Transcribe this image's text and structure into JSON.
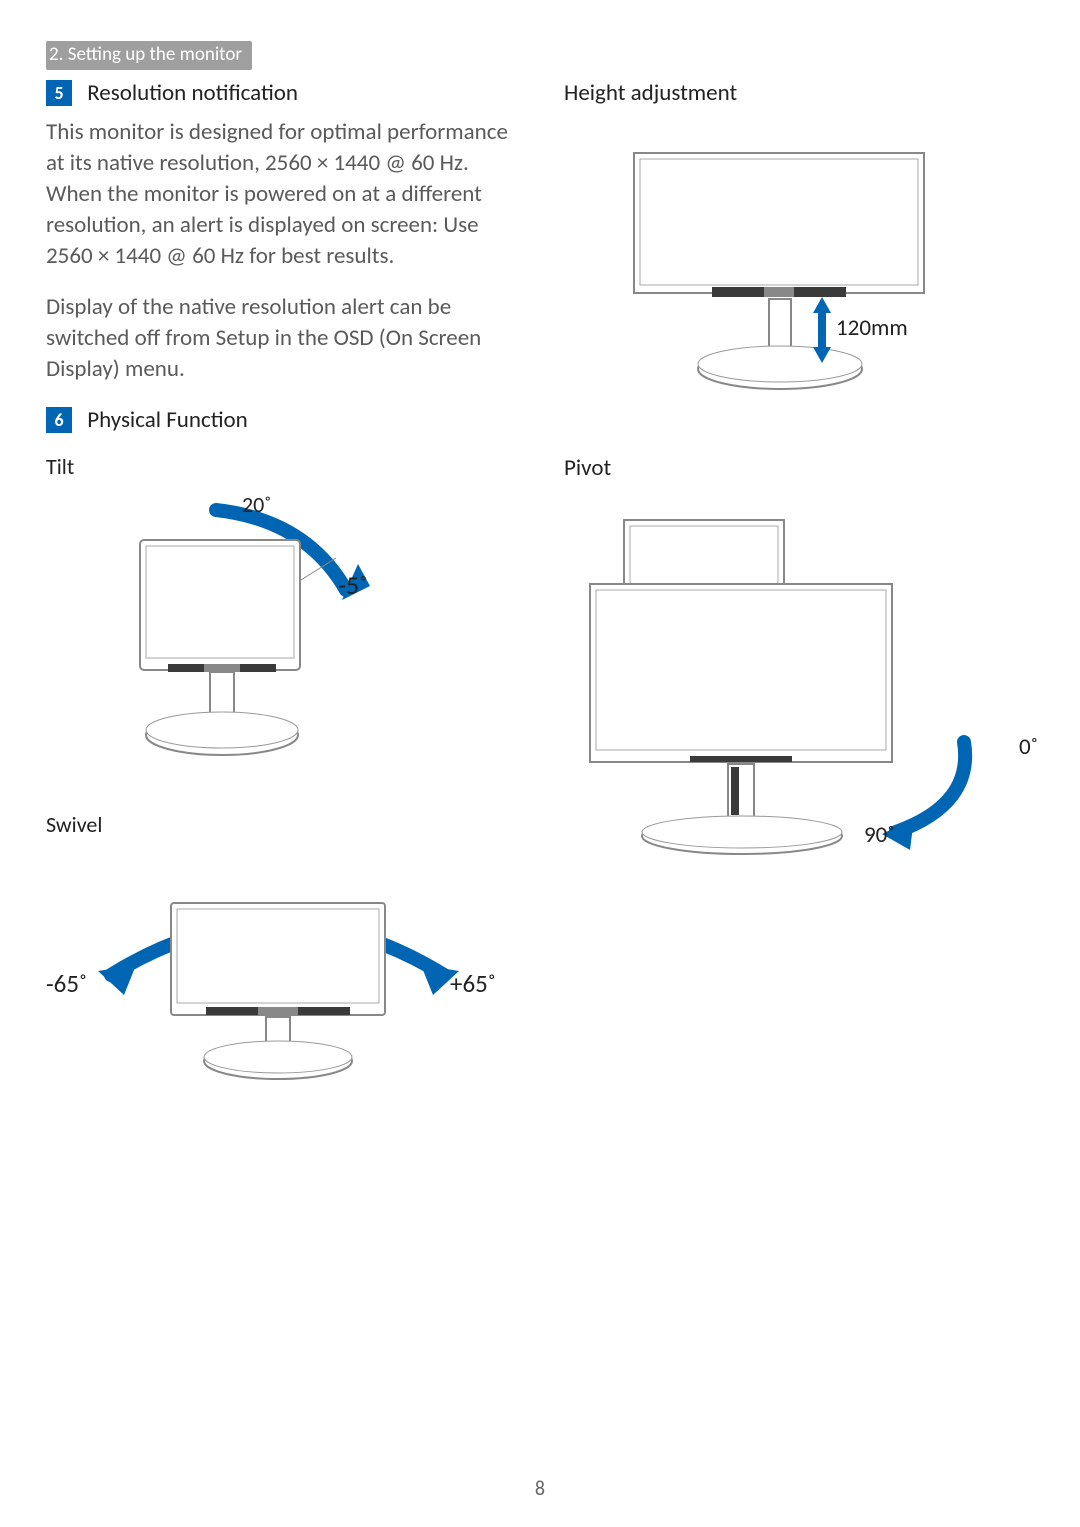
{
  "section_tag": "2. Setting up the monitor",
  "left": {
    "item5_num": "5",
    "item5_title": "Resolution notification",
    "para1": "This monitor is designed for optimal performance at its native resolution, 2560 × 1440 @ 60 Hz. When the monitor is powered on at a different resolution, an alert is displayed on screen: Use 2560 × 1440 @ 60 Hz for best results.",
    "para2": "Display of the native resolution alert can be switched off from Setup in the OSD (On Screen Display) menu.",
    "item6_num": "6",
    "item6_title": "Physical Function",
    "tilt_h": "Tilt",
    "tilt_back": "20˚",
    "tilt_fwd": "-5˚",
    "swivel_h": "Swivel",
    "swivel_left": "-65˚",
    "swivel_right": "+65˚"
  },
  "right": {
    "height_h": "Height adjustment",
    "height_val": "120mm",
    "pivot_h": "Pivot",
    "pivot_top": "0˚",
    "pivot_bot": "90˚"
  },
  "page_number": "8"
}
